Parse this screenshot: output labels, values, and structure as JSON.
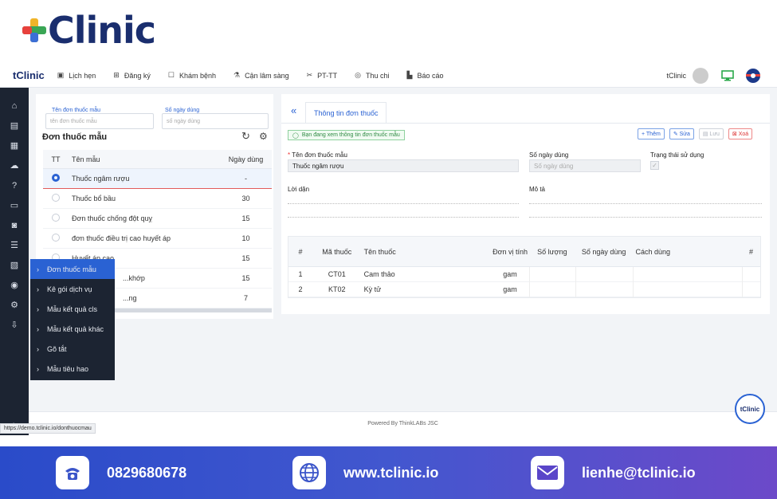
{
  "hero_brand": "Clinic",
  "nav": {
    "brand": "tClinic",
    "items": [
      {
        "label": "Lịch hẹn",
        "icon": "calendar-icon",
        "glyph": "▣"
      },
      {
        "label": "Đăng ký",
        "icon": "register-icon",
        "glyph": "⊞"
      },
      {
        "label": "Khám bệnh",
        "icon": "exam-icon",
        "glyph": "☐"
      },
      {
        "label": "Cận lâm sàng",
        "icon": "lab-icon",
        "glyph": "⚗"
      },
      {
        "label": "PT-TT",
        "icon": "scissors-icon",
        "glyph": "✂"
      },
      {
        "label": "Thu chi",
        "icon": "money-icon",
        "glyph": "◎"
      },
      {
        "label": "Báo cáo",
        "icon": "report-icon",
        "glyph": "▙"
      }
    ],
    "user": "tClinic"
  },
  "filter": {
    "name_label": "Tên đơn thuốc mẫu",
    "name_placeholder": "tên đơn thuốc mẫu",
    "days_label": "Số ngày dùng",
    "days_placeholder": "số ngày dùng"
  },
  "list": {
    "title": "Đơn thuốc mẫu",
    "headers": [
      "TT",
      "Tên mẫu",
      "Ngày dùng"
    ],
    "rows": [
      {
        "name": "Thuốc ngâm rượu",
        "days": "-",
        "selected": true
      },
      {
        "name": "Thuốc bổ bầu",
        "days": "30",
        "selected": false
      },
      {
        "name": "Đơn thuốc chống đột quỵ",
        "days": "15",
        "selected": false
      },
      {
        "name": "đơn thuốc điều trị cao huyết áp",
        "days": "10",
        "selected": false
      },
      {
        "name": "Huyết áp cao",
        "days": "15",
        "selected": false
      },
      {
        "name": "...khớp",
        "days": "15",
        "selected": false
      },
      {
        "name": "...ng",
        "days": "7",
        "selected": false
      }
    ]
  },
  "submenu": [
    {
      "label": "Đơn thuốc mẫu",
      "active": true
    },
    {
      "label": "Kê gói dịch vụ",
      "active": false
    },
    {
      "label": "Mẫu kết quả cls",
      "active": false
    },
    {
      "label": "Mẫu kết quả khác",
      "active": false
    },
    {
      "label": "Gõ tắt",
      "active": false
    },
    {
      "label": "Mẫu tiêu hao",
      "active": false
    }
  ],
  "detail": {
    "back": "«",
    "tab": "Thông tin đơn thuốc",
    "status": "Bạn đang xem thông tin đơn thuốc mẫu",
    "buttons": {
      "add": "+ Thêm",
      "edit": "✎ Sửa",
      "save": "▤ Lưu",
      "delete": "⊠ Xoá"
    },
    "name_label": "Tên đơn thuốc mẫu",
    "name_value": "Thuốc ngâm rượu",
    "days_label": "Số ngày dùng",
    "days_placeholder": "Số ngày dùng",
    "active_label": "Trạng thái sử dụng",
    "advice_label": "Lời dặn",
    "desc_label": "Mô tả",
    "table_headers": [
      "#",
      "Mã thuốc",
      "Tên thuốc",
      "Đơn vị tính",
      "Số lượng",
      "Số ngày dùng",
      "Cách dùng",
      "#"
    ],
    "drugs": [
      {
        "idx": "1",
        "code": "CT01",
        "name": "Cam thảo",
        "unit": "gam"
      },
      {
        "idx": "2",
        "code": "KT02",
        "name": "Kỳ tử",
        "unit": "gam"
      }
    ]
  },
  "powered": "Powered By ThinkLABs JSC",
  "status_url": "https://demo.tclinic.io/donthuocmau",
  "chat_bubble": "tClinic",
  "contact": {
    "phone": "0829680678",
    "website": "www.tclinic.io",
    "email": "lienhe@tclinic.io"
  }
}
